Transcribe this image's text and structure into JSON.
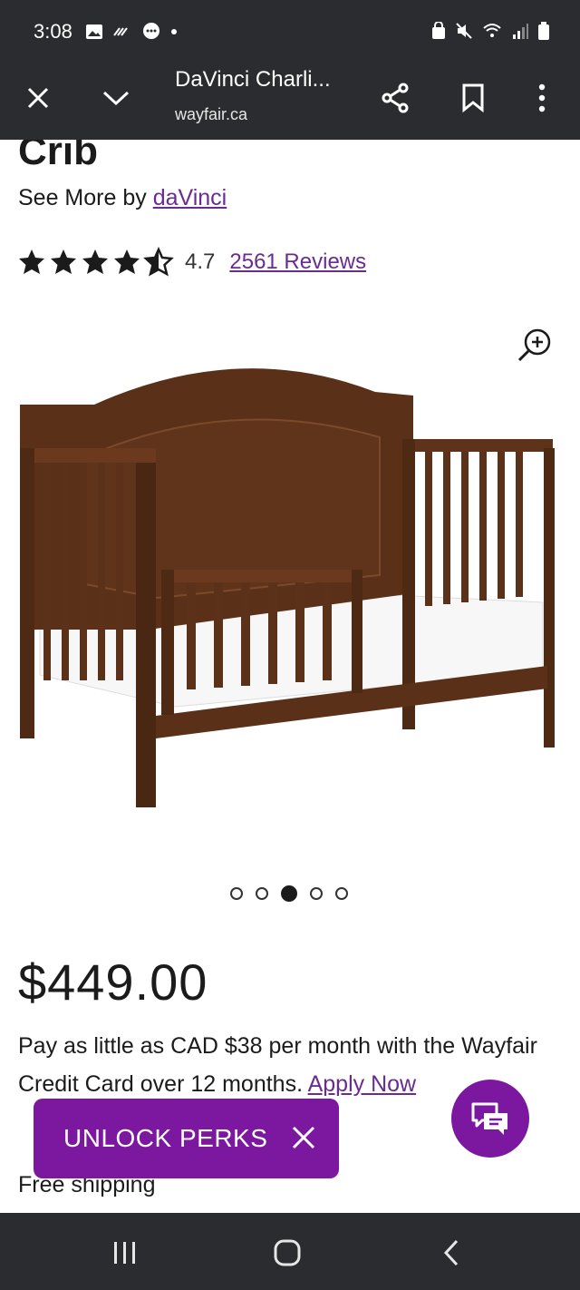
{
  "status_bar": {
    "time": "3:08"
  },
  "browser": {
    "title": "DaVinci Charli...",
    "url": "wayfair.ca"
  },
  "product": {
    "title_tail": "Crib",
    "see_more_prefix": "See More by ",
    "brand": "daVinci",
    "rating": "4.7",
    "reviews": "2561 Reviews",
    "stars_filled": 4.7,
    "image_count": 5,
    "active_image_index": 2,
    "price": "$449.00",
    "financing_text": "Pay as little as CAD $38 per month with the Wayfair Credit Card over 12 months. ",
    "financing_link": "Apply Now",
    "shipping": "Free shipping"
  },
  "perks_banner": {
    "label": "UNLOCK PERKS"
  },
  "colors": {
    "accent": "#7b189f",
    "link": "#6b2c91",
    "chrome": "#2b2c2f"
  }
}
